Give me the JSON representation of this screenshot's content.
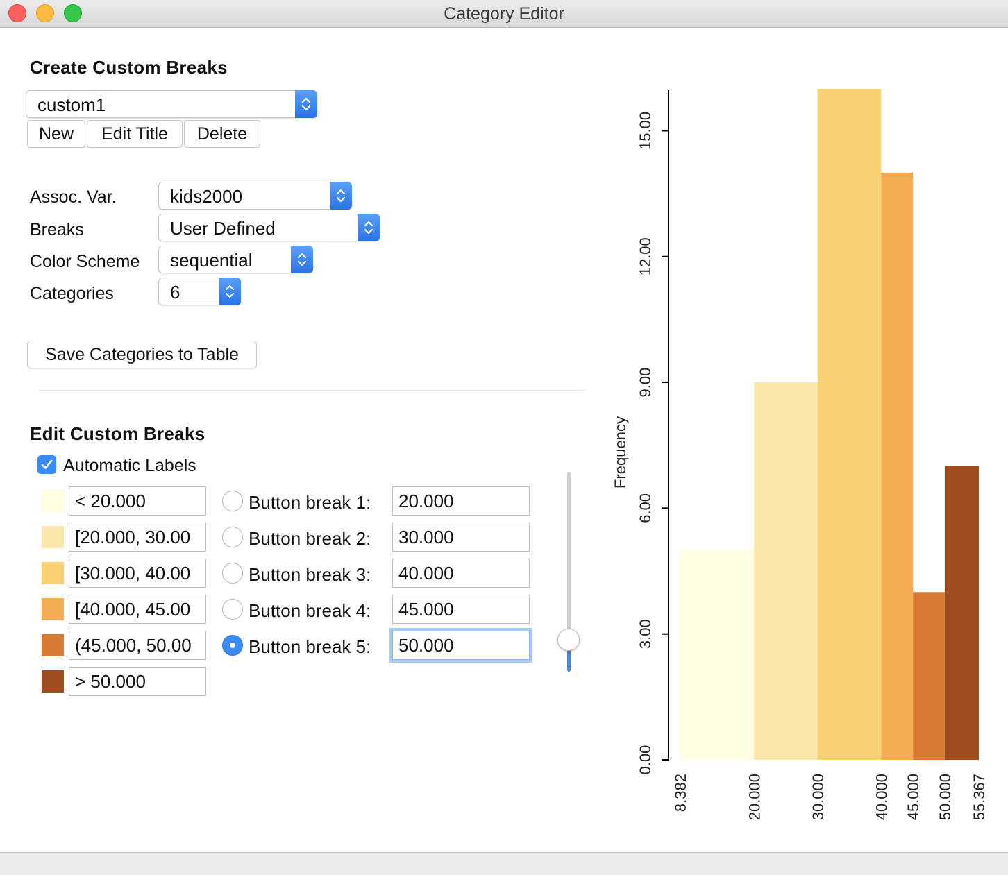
{
  "window": {
    "title": "Category Editor"
  },
  "create": {
    "title": "Create Custom Breaks",
    "selected": "custom1",
    "buttons": {
      "new": "New",
      "edit_title": "Edit Title",
      "delete": "Delete"
    },
    "assoc_var": {
      "label": "Assoc. Var.",
      "value": "kids2000"
    },
    "breaks": {
      "label": "Breaks",
      "value": "User Defined"
    },
    "color_scheme": {
      "label": "Color Scheme",
      "value": "sequential"
    },
    "categories": {
      "label": "Categories",
      "value": "6"
    },
    "save_button": "Save Categories to Table"
  },
  "edit": {
    "title": "Edit Custom Breaks",
    "automatic_labels": {
      "label": "Automatic Labels",
      "checked": true
    },
    "categories": [
      {
        "label": "< 20.000",
        "color": "#ffffe2"
      },
      {
        "label": "[20.000, 30.00",
        "color": "#fbe7aa"
      },
      {
        "label": "[30.000, 40.00",
        "color": "#f8d172"
      },
      {
        "label": "[40.000, 45.00",
        "color": "#f3ac51"
      },
      {
        "label": "(45.000, 50.00",
        "color": "#d87a33"
      },
      {
        "label": "> 50.000",
        "color": "#9f4c1f"
      }
    ],
    "breaks": [
      {
        "label": "Button break 1:",
        "value": "20.000",
        "selected": false
      },
      {
        "label": "Button break 2:",
        "value": "30.000",
        "selected": false
      },
      {
        "label": "Button break 3:",
        "value": "40.000",
        "selected": false
      },
      {
        "label": "Button break 4:",
        "value": "45.000",
        "selected": false
      },
      {
        "label": "Button break 5:",
        "value": "50.000",
        "selected": true
      }
    ],
    "slider_fraction": 0.15
  },
  "chart_data": {
    "type": "bar",
    "ylabel": "Frequency",
    "yticks": [
      "0.00",
      "3.00",
      "6.00",
      "9.00",
      "12.00",
      "15.00"
    ],
    "ylim": [
      0,
      16
    ],
    "xticks": [
      "8.382",
      "20.000",
      "30.000",
      "40.000",
      "45.000",
      "50.000",
      "55.367"
    ],
    "bins": [
      {
        "from": 8.382,
        "to": 20.0,
        "count": 5,
        "color": "#ffffe2"
      },
      {
        "from": 20.0,
        "to": 30.0,
        "count": 9,
        "color": "#fbe7aa"
      },
      {
        "from": 30.0,
        "to": 40.0,
        "count": 16,
        "color": "#f8d172"
      },
      {
        "from": 40.0,
        "to": 45.0,
        "count": 14,
        "color": "#f3ac51"
      },
      {
        "from": 45.0,
        "to": 50.0,
        "count": 4,
        "color": "#d87a33"
      },
      {
        "from": 50.0,
        "to": 55.367,
        "count": 7,
        "color": "#9f4c1f"
      }
    ]
  }
}
